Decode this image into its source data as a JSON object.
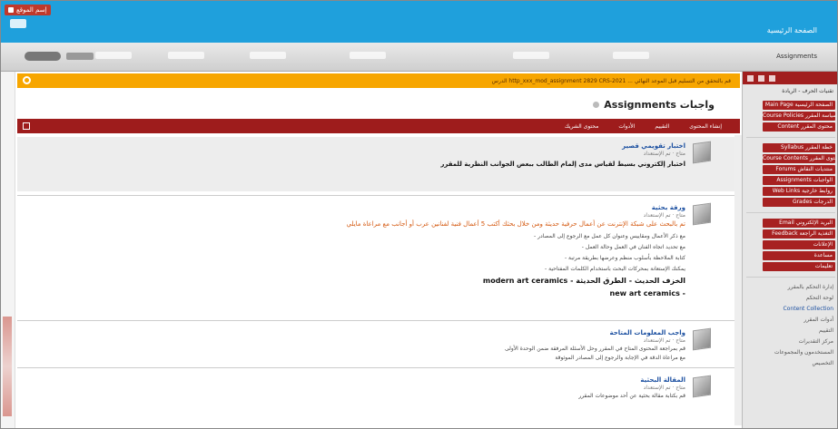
{
  "window": {
    "tab_label": "إسم الموقع"
  },
  "header": {
    "site_title": "الصفحة الرئيسية"
  },
  "nav": {
    "user_label": "Assignments",
    "items": [
      "",
      "",
      "",
      "",
      "",
      ""
    ]
  },
  "alert": {
    "text": "الدرس http_xxx_mod_assignment 2829 CRS-2021 ... قم بالتحقق من التسليم قبل الموعد النهائي"
  },
  "page": {
    "title": "Assignments واجبات"
  },
  "toolbar": {
    "items": [
      "إنشاء المحتوى",
      "التقييم",
      "الأدوات",
      "محتوى الشريك"
    ]
  },
  "items": [
    {
      "title": "اختبار تقويمي قصير",
      "status": "متاح · تم الإستعداد",
      "lines": [
        "اختبار إلكتروني بسيط لقياس مدى إلمام الطالب ببعض الجوانب النظرية للمقرر"
      ]
    },
    {
      "title": "ورقة بحثية",
      "status": "متاح · تم الإستعداد",
      "orange": "تم بالبحث على شبكة الإنترنت عن أعمال حرفية حديثة ومن خلال بحثك أكتب 5 أعمال فنية لفنانين عرب أو أجانب مع مراعاة مايلي",
      "lines": [
        "- مع ذكر الأعمال ومقاييس وعنوان كل عمل مع الرجوع إلى المصادر",
        "- مع تحديد اتجاه الفنان في العمل وحالة العمل",
        "- كتابة الملاحظة بأسلوب منظم وعرضها بطريقة مرتبة",
        "- يمكنك الإستعانة بمحركات البحث باستخدام الكلمات المفتاحية"
      ],
      "keyword_line": "modern art ceramics - الخزف الحديث - الطرق الحديثة",
      "keyword_line2": "new art ceramics -"
    },
    {
      "title": "واجب المعلومات المتاحة",
      "status": "متاح · تم الإستعداد",
      "lines": [
        "قم بمراجعة المحتوى المتاح في المقرر وحل الأسئلة المرفقة ضمن الوحدة الأولى",
        "مع مراعاة الدقة في الإجابة والرجوع إلى المصادر الموثوقة"
      ]
    },
    {
      "title": "المقالة البحثية",
      "status": "متاح · تم الإستعداد",
      "lines": [
        "قم بكتابة مقالة بحثية عن أحد موضوعات المقرر"
      ]
    }
  ],
  "sidebar": {
    "course_title": "تقنيات الحرف - الريادة",
    "group1": [
      "Main Page الصفحة الرئيسية",
      "Course Policies سياسة المقرر",
      "Content محتوى المقرر"
    ],
    "group2": [
      "Syllabus خطة المقرر",
      "Course Contents محتوى المقرر",
      "Forums منتديات النقاش",
      "Assignments الواجبات",
      "Web Links روابط خارجية",
      "Grades الدرجات"
    ],
    "group3": [
      "Email البريد الإلكتروني",
      "Feedback التغذية الراجعة",
      "الإعلانات",
      "مساعدة",
      "تعليمات"
    ],
    "group4": [
      "إدارة التحكم بالمقرر",
      "لوحة التحكم",
      "Content Collection",
      "أدوات المقرر",
      "التقييم",
      "مركز التقديرات",
      "المستخدمون والمجموعات",
      "التخصيص"
    ]
  }
}
